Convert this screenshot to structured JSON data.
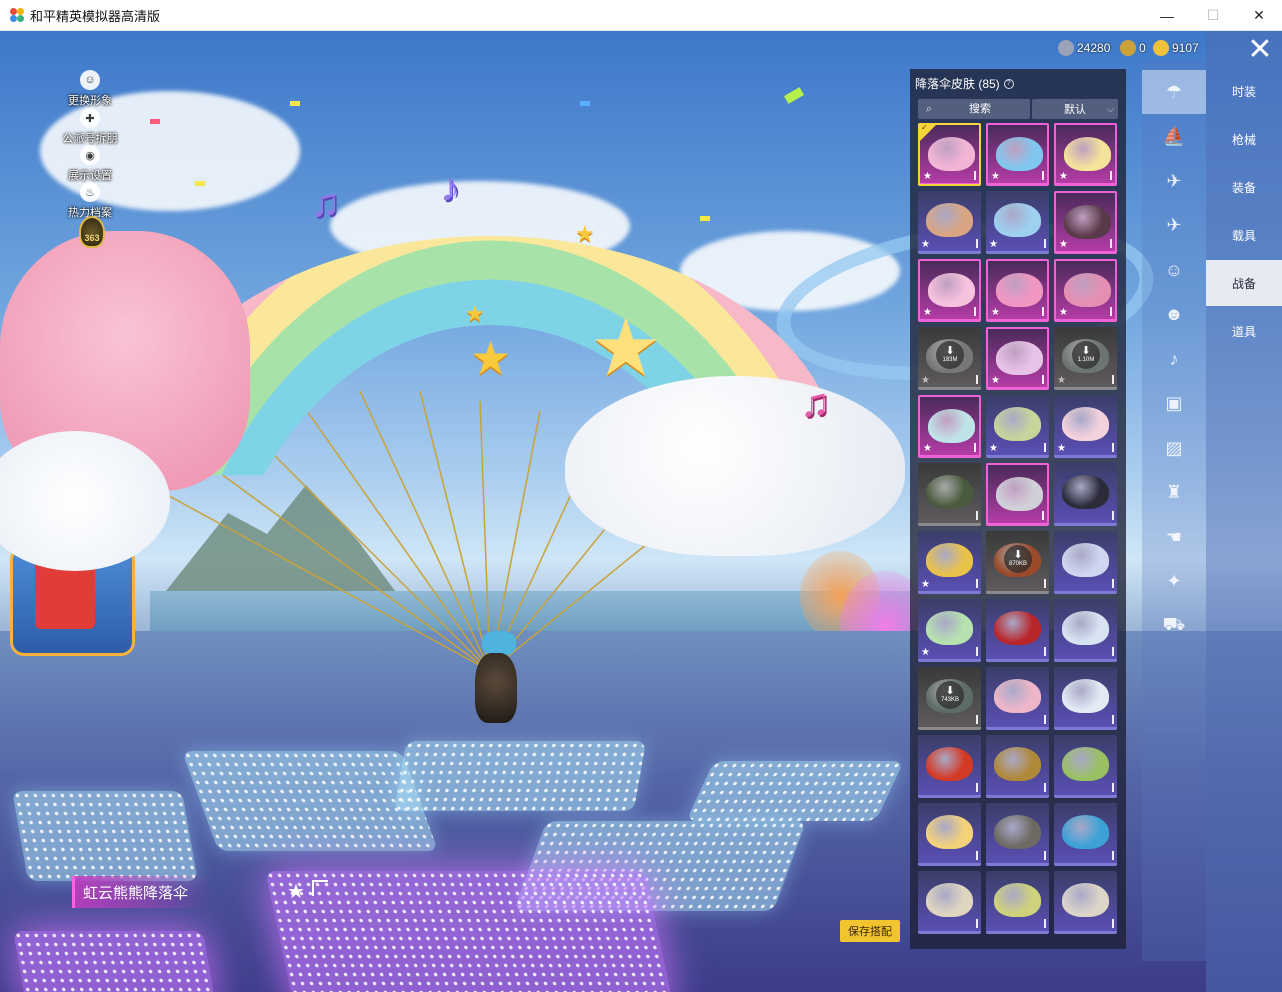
{
  "window": {
    "title": "和平精英模拟器高清版",
    "controls": {
      "minimize": "—",
      "maximize": "☐",
      "close": "✕"
    }
  },
  "left_menu": [
    {
      "label": "更换形象",
      "icon": "person-icon"
    },
    {
      "label": "公派号拆朋",
      "icon": "gear-icon"
    },
    {
      "label": "展示设置",
      "icon": "eye-icon"
    },
    {
      "label": "热力档案",
      "icon": "flame-icon"
    }
  ],
  "level_badge": "363",
  "currency": {
    "silver": "24280",
    "coupon": "0",
    "gold": "9107",
    "colors": {
      "silver": "#9aa3b8",
      "coupon": "#c9a23a",
      "gold": "#f0c23a"
    }
  },
  "close_icon": "✕",
  "panel": {
    "title": "降落伞皮肤 (85)",
    "help_icon": "?",
    "search_placeholder": "搜索",
    "sort_label": "默认",
    "sort_chevron": "⌵"
  },
  "skins": [
    {
      "style": "pink",
      "color": "#f3b5d6",
      "selected": true,
      "star": "★"
    },
    {
      "style": "pink",
      "color": "#7fc7ee",
      "star": "★"
    },
    {
      "style": "pink",
      "color": "#f5e39a",
      "star": "★"
    },
    {
      "style": "normal",
      "color": "#d9a583",
      "star": "★"
    },
    {
      "style": "normal",
      "color": "#9ed0f0",
      "star": "★"
    },
    {
      "style": "pink",
      "color": "#5a3a4a",
      "star": "★"
    },
    {
      "style": "pink",
      "color": "#f7c2dd",
      "star": "★"
    },
    {
      "style": "pink",
      "color": "#f296c2",
      "star": "★"
    },
    {
      "style": "pink",
      "color": "#e58fb2",
      "star": "★"
    },
    {
      "style": "dark",
      "color": "#777777",
      "star": "★",
      "download": "183M"
    },
    {
      "style": "pink",
      "color": "#e8c3e8",
      "star": "★"
    },
    {
      "style": "dark",
      "color": "#6d7570",
      "star": "★",
      "download": "1.10M"
    },
    {
      "style": "pink",
      "color": "#bfe4e8",
      "star": "★"
    },
    {
      "style": "normal",
      "color": "#c8d59a",
      "star": "★"
    },
    {
      "style": "normal",
      "color": "#f4d2dc",
      "star": "★"
    },
    {
      "style": "dark",
      "color": "#4a5a3e",
      "star": ""
    },
    {
      "style": "pink",
      "color": "#d0d0d8",
      "star": ""
    },
    {
      "style": "normal",
      "color": "#2b2b3a",
      "star": ""
    },
    {
      "style": "normal",
      "color": "#e9c24a",
      "star": "★"
    },
    {
      "style": "dark",
      "color": "#9a4a2a",
      "star": "",
      "download": "870KB"
    },
    {
      "style": "normal",
      "color": "#cfd6ef",
      "star": ""
    },
    {
      "style": "normal",
      "color": "#b7e2b0",
      "star": "★"
    },
    {
      "style": "normal",
      "color": "#b8262a",
      "star": ""
    },
    {
      "style": "normal",
      "color": "#d8e4f2",
      "star": ""
    },
    {
      "style": "dark",
      "color": "#5d6c66",
      "star": "",
      "download": "743KB"
    },
    {
      "style": "normal",
      "color": "#eeb7c9",
      "star": ""
    },
    {
      "style": "normal",
      "color": "#e3eaf4",
      "star": ""
    },
    {
      "style": "normal",
      "color": "#d33a26",
      "star": ""
    },
    {
      "style": "normal",
      "color": "#b0883a",
      "star": ""
    },
    {
      "style": "normal",
      "color": "#9ac064",
      "star": ""
    },
    {
      "style": "normal",
      "color": "#f3d27a",
      "star": ""
    },
    {
      "style": "normal",
      "color": "#6d6a64",
      "star": ""
    },
    {
      "style": "normal",
      "color": "#3ca2d6",
      "star": ""
    },
    {
      "style": "normal",
      "color": "#e0d6c0",
      "star": ""
    },
    {
      "style": "normal",
      "color": "#cfd27a",
      "star": ""
    },
    {
      "style": "normal",
      "color": "#dcd5c8",
      "star": ""
    }
  ],
  "category_icons": [
    {
      "name": "parachute-icon",
      "glyph": "☂",
      "active": true
    },
    {
      "name": "glider-icon",
      "glyph": "⛵"
    },
    {
      "name": "drone-icon",
      "glyph": "✈"
    },
    {
      "name": "plane-icon",
      "glyph": "✈"
    },
    {
      "name": "emote-icon",
      "glyph": "☺"
    },
    {
      "name": "robot-icon",
      "glyph": "☻"
    },
    {
      "name": "sound-icon",
      "glyph": "♪"
    },
    {
      "name": "box-icon",
      "glyph": "▣"
    },
    {
      "name": "photo-icon",
      "glyph": "▨"
    },
    {
      "name": "spray-icon",
      "glyph": "♜"
    },
    {
      "name": "hand-icon",
      "glyph": "☚"
    },
    {
      "name": "effect-icon",
      "glyph": "✦"
    },
    {
      "name": "vehicle-icon",
      "glyph": "⛟"
    }
  ],
  "right_tabs": [
    {
      "label": "时装"
    },
    {
      "label": "枪械"
    },
    {
      "label": "装备"
    },
    {
      "label": "载具"
    },
    {
      "label": "战备",
      "active": true
    },
    {
      "label": "道具"
    }
  ],
  "bottom": {
    "skin_name": "虹云熊熊降落伞",
    "fav_icon": "★",
    "save_label": "保存搭配"
  }
}
